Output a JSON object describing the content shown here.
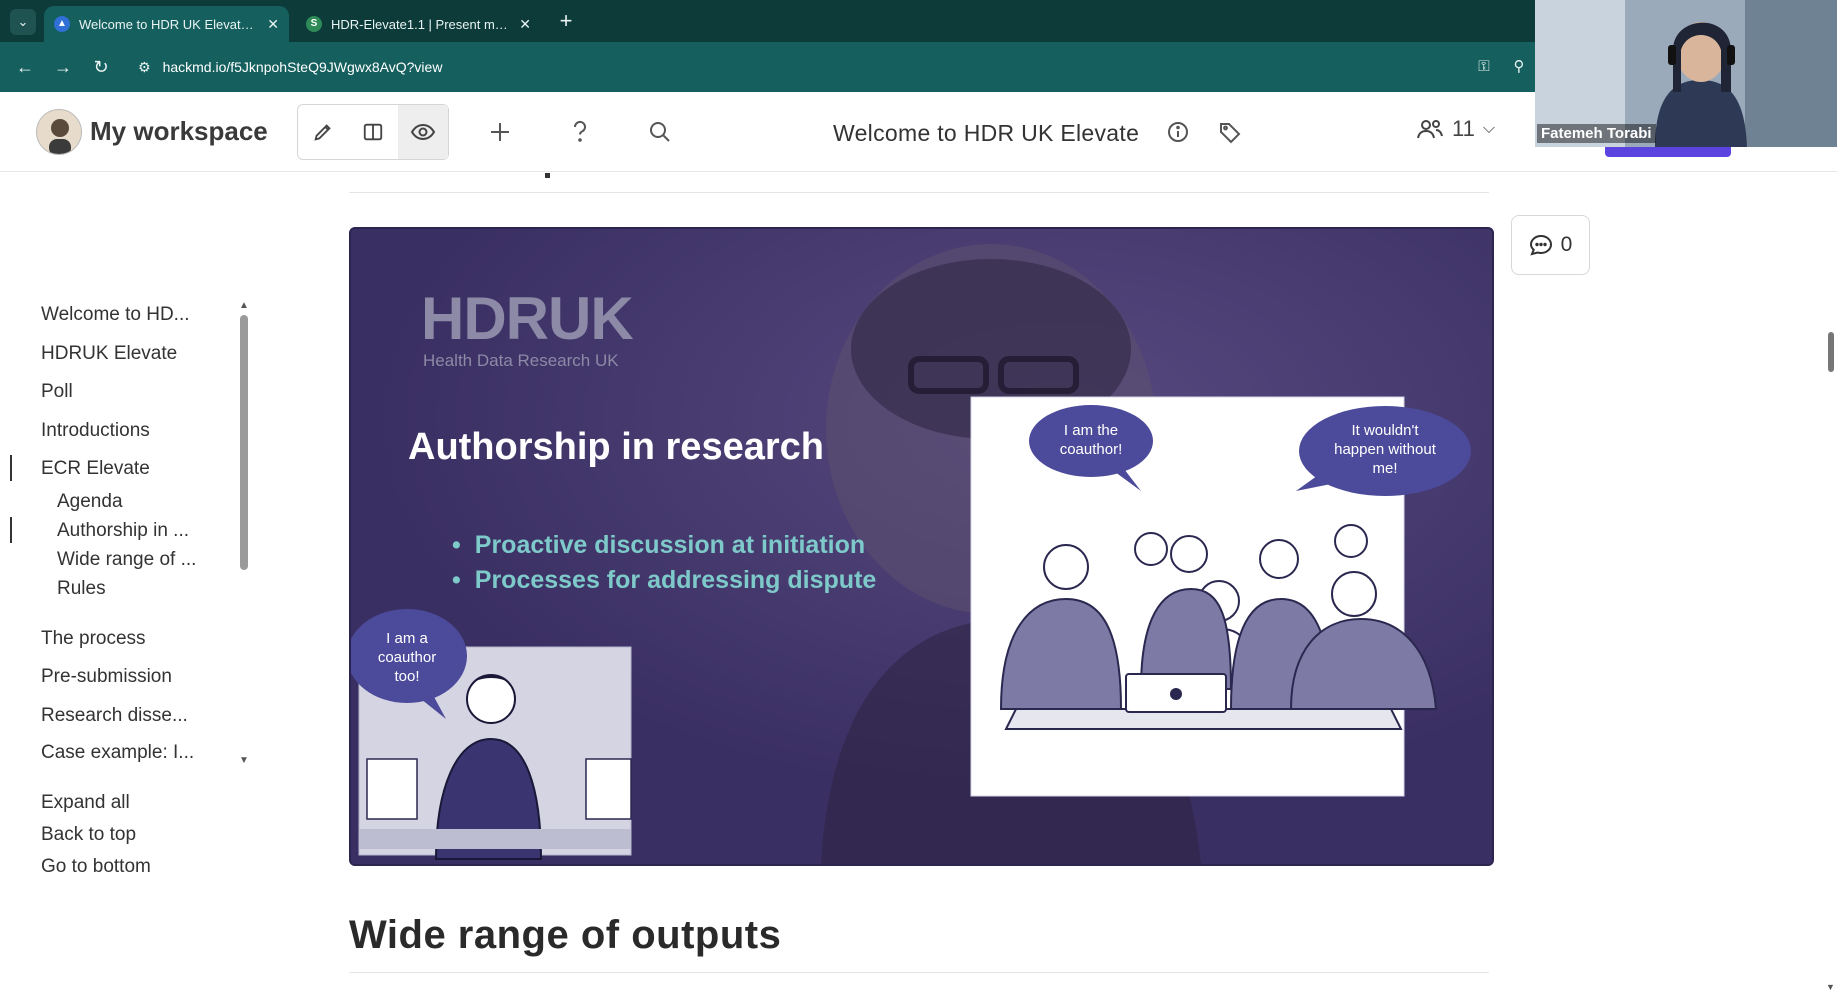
{
  "browser": {
    "tabs": [
      {
        "title": "Welcome to HDR UK Elevate - I",
        "active": true
      },
      {
        "title": "HDR-Elevate1.1 | Present mode",
        "active": false
      }
    ],
    "url": "hackmd.io/f5JknpohSteQ9JWgwx8AvQ?view"
  },
  "header": {
    "workspace_title": "My workspace",
    "doc_title": "Welcome to HDR UK Elevate",
    "collaborator_count": "11"
  },
  "webcam": {
    "name": "Fatemeh Torabi"
  },
  "toc": {
    "items": [
      {
        "label": "Welcome to HD..."
      },
      {
        "label": "HDRUK Elevate"
      },
      {
        "label": "Poll"
      },
      {
        "label": "Introductions"
      },
      {
        "label": "ECR Elevate"
      },
      {
        "label": "Agenda"
      },
      {
        "label": "Authorship in ..."
      },
      {
        "label": "Wide range of ..."
      },
      {
        "label": "Rules"
      },
      {
        "label": "The process"
      },
      {
        "label": "Pre-submission"
      },
      {
        "label": "Research disse..."
      },
      {
        "label": "Case example: I..."
      }
    ],
    "actions": [
      {
        "label": "Expand all"
      },
      {
        "label": "Back to top"
      },
      {
        "label": "Go to bottom"
      }
    ]
  },
  "slide": {
    "logo_main": "HDRUK",
    "logo_sub": "Health Data Research UK",
    "title": "Authorship in research",
    "bullets": [
      "Proactive discussion at initiation",
      "Processes for addressing dispute"
    ],
    "bubbles": {
      "coauthor": "I am the coauthor!",
      "wouldnt": "It wouldn't happen without me!",
      "too": "I am a coauthor too!"
    }
  },
  "comments": {
    "count": "0"
  },
  "content": {
    "section_heading": "Wide range of outputs"
  },
  "colors": {
    "chrome_dark": "#0c3b3a",
    "chrome": "#15605e",
    "slide_bg": "#40346a",
    "bullet_text": "#7ec9c9",
    "bubble": "#4c4a9a"
  }
}
